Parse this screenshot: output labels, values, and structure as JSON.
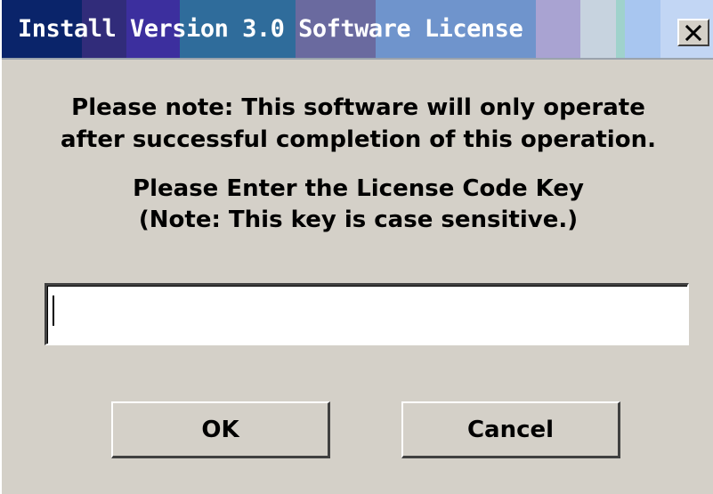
{
  "window": {
    "title": "Install Version 3.0 Software License",
    "close_icon": "close-icon"
  },
  "message": {
    "line1": "Please note: This software will only operate",
    "line2": "after successful completion of this operation.",
    "line3": "Please Enter the License Code Key",
    "line4": "(Note: This key is case sensitive.)"
  },
  "license_input": {
    "value": "",
    "placeholder": ""
  },
  "buttons": {
    "ok_label": "OK",
    "cancel_label": "Cancel"
  },
  "colors": {
    "dialog_background": "#d4d0c8",
    "title_text": "#ffffff"
  }
}
